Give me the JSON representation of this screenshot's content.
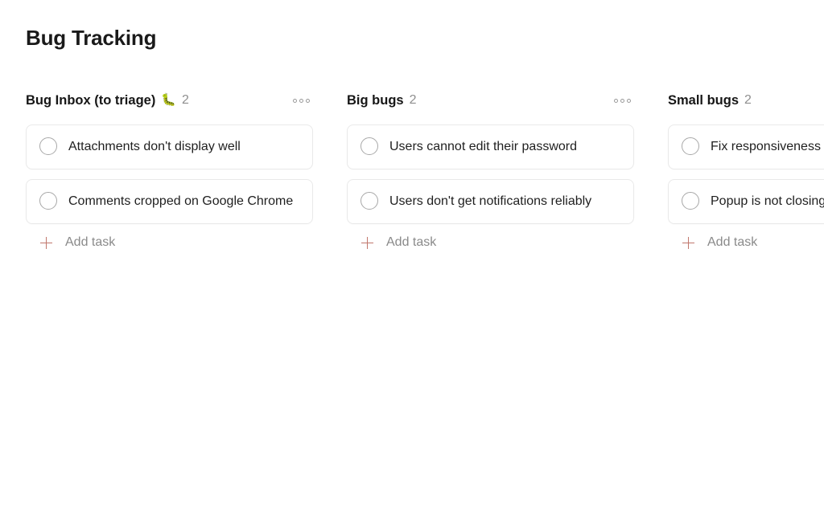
{
  "page": {
    "title": "Bug Tracking"
  },
  "colors": {
    "background": "#ffffff",
    "card_border": "#e9e9e9",
    "text_primary": "#1f1f1f",
    "text_muted": "#8a8a8a",
    "accent_plus": "#c1776c",
    "checkbox_border": "#a8a8a8"
  },
  "columns": [
    {
      "title": "Bug Inbox (to triage)",
      "emoji": "🐛",
      "emoji_name": "bug-emoji",
      "count": "2",
      "menu_icon": "more-horizontal-icon",
      "add_task_label": "Add task",
      "add_task_icon": "plus-icon",
      "cards": [
        {
          "text": "Attachments don't display well",
          "checkbox_icon": "circle-checkbox-icon"
        },
        {
          "text": "Comments cropped on Google Chrome",
          "checkbox_icon": "circle-checkbox-icon"
        }
      ]
    },
    {
      "title": "Big bugs",
      "emoji": "",
      "emoji_name": "",
      "count": "2",
      "menu_icon": "more-horizontal-icon",
      "add_task_label": "Add task",
      "add_task_icon": "plus-icon",
      "cards": [
        {
          "text": "Users cannot edit their password",
          "checkbox_icon": "circle-checkbox-icon"
        },
        {
          "text": "Users don't get notifications reliably",
          "checkbox_icon": "circle-checkbox-icon"
        }
      ]
    },
    {
      "title": "Small bugs",
      "emoji": "",
      "emoji_name": "",
      "count": "2",
      "menu_icon": "more-horizontal-icon",
      "add_task_label": "Add task",
      "add_task_icon": "plus-icon",
      "cards": [
        {
          "text": "Fix responsiveness",
          "checkbox_icon": "circle-checkbox-icon"
        },
        {
          "text": "Popup is not closing",
          "checkbox_icon": "circle-checkbox-icon"
        }
      ]
    }
  ]
}
